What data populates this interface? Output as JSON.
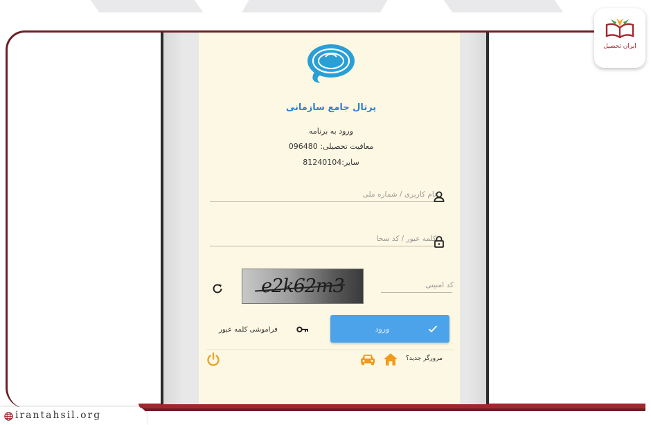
{
  "portal": {
    "title": "پرتال جامع سازمانی",
    "login_line": "ورود به برنامه",
    "education_line": "معافیت تحصیلی: 096480",
    "other_line": "سایر:81240104"
  },
  "form": {
    "username_placeholder": "نام کاربری / شماره ملی",
    "password_placeholder": "کلمه عبور / کد سخا",
    "security_placeholder": "کد امنیتی",
    "captcha_text": "e2k62m3",
    "login_label": "ورود",
    "forgot_label": "فراموشی کلمه عبور"
  },
  "footer": {
    "new_browser_label": "مرورگر جدید؟"
  },
  "badge": {
    "label": "ایران تحصیل"
  },
  "site": {
    "url": "irantahsil.org"
  },
  "colors": {
    "accent": "#4da3ea",
    "title": "#2d7fd3",
    "brand": "#a3262e",
    "home": "#f29a1a",
    "power": "#e7a52a"
  },
  "icons": [
    "user-icon",
    "lock-icon",
    "refresh-icon",
    "check-icon",
    "key-icon",
    "home-icon",
    "car-icon",
    "power-icon",
    "globe-icon",
    "book-logo-icon"
  ]
}
